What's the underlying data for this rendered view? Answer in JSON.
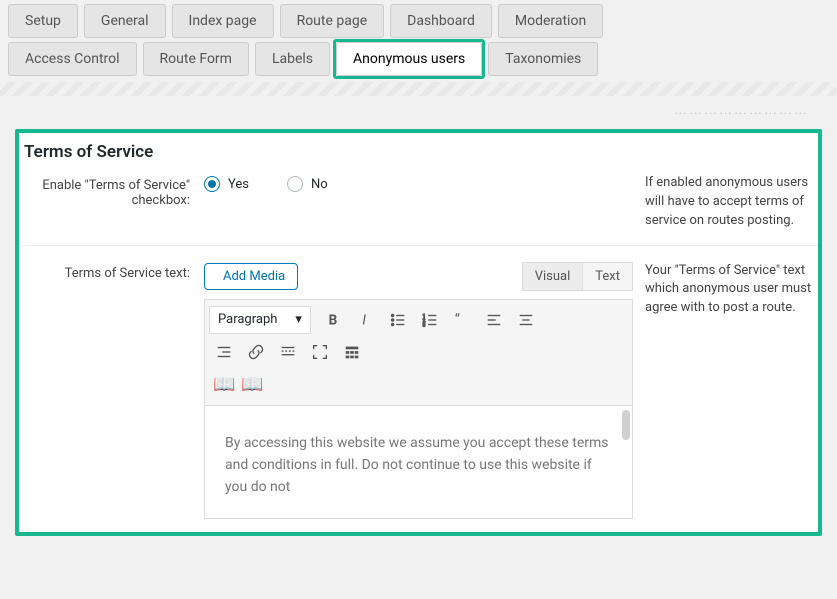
{
  "tabs_row1": [
    "Setup",
    "General",
    "Index page",
    "Route page",
    "Dashboard",
    "Moderation"
  ],
  "tabs_row2": [
    "Access Control",
    "Route Form",
    "Labels",
    "Anonymous users",
    "Taxonomies"
  ],
  "active_tab": "Anonymous users",
  "panel": {
    "title": "Terms of Service",
    "row1": {
      "label": "Enable \"Terms of Service\" checkbox:",
      "option_yes": "Yes",
      "option_no": "No",
      "selected": "Yes",
      "help": "If enabled anonymous users will have to accept terms of service on routes posting."
    },
    "row2": {
      "label": "Terms of Service text:",
      "add_media": "Add Media",
      "tab_visual": "Visual",
      "tab_text": "Text",
      "paragraph_label": "Paragraph",
      "textarea_value": "By accessing this website we assume you accept these terms and conditions in full. Do not continue to use this website if you do not",
      "help": "Your \"Terms of Service\" text which anonymous user must agree with to post a route."
    }
  }
}
